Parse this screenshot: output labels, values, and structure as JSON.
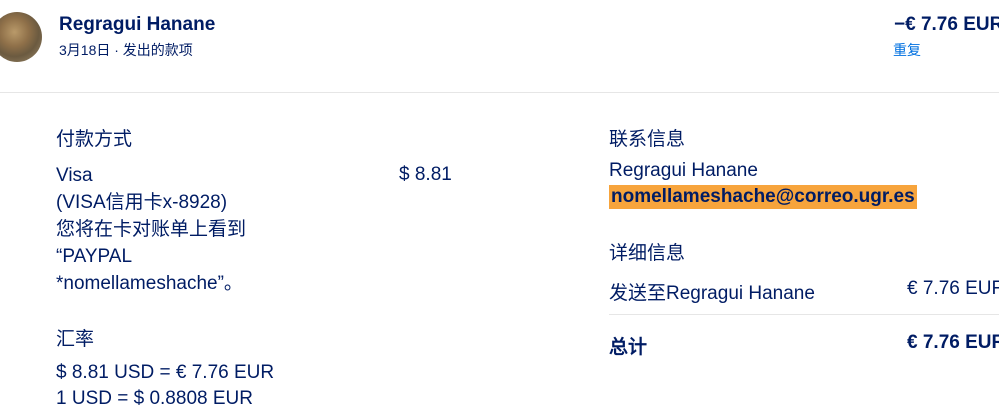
{
  "header": {
    "name": "Regragui Hanane",
    "subtitle": "3月18日 · 发出的款项",
    "amount": "−€ 7.76 EUR",
    "repeat_link": "重复"
  },
  "payment": {
    "section_title": "付款方式",
    "method_lines": [
      "Visa",
      "(VISA信用卡x-8928)",
      "您将在卡对账单上看到",
      "“PAYPAL",
      "*nomellameshache”。"
    ],
    "amount": "$ 8.81"
  },
  "exchange": {
    "section_title": "汇率",
    "line1": "$ 8.81 USD = € 7.76 EUR",
    "line2": "1 USD = $ 0.8808 EUR"
  },
  "contact": {
    "section_title": "联系信息",
    "name": "Regragui Hanane",
    "email": "nomellameshache@correo.ugr.es"
  },
  "details": {
    "section_title": "详细信息",
    "send_to_label": "发送至Regragui Hanane",
    "send_to_amount": "€ 7.76 EUR",
    "total_label": "总计",
    "total_amount": "€ 7.76 EUR"
  }
}
